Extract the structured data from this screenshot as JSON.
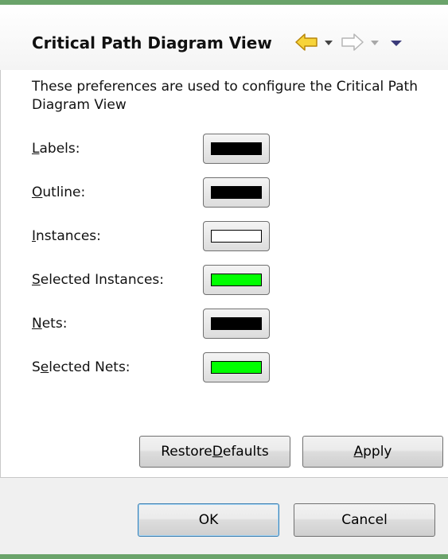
{
  "header": {
    "title": "Critical Path Diagram View",
    "icons": [
      "back-arrow-icon",
      "back-history-dropdown-icon",
      "forward-arrow-icon",
      "forward-history-dropdown-icon",
      "view-menu-icon"
    ]
  },
  "description": "These preferences are used to configure the Critical Path Diagram View",
  "preferences": [
    {
      "mnemonic": "L",
      "rest": "abels:",
      "color": "#000000"
    },
    {
      "mnemonic": "O",
      "rest": "utline:",
      "color": "#000000"
    },
    {
      "mnemonic": "I",
      "rest": "nstances:",
      "color": "#ffffff"
    },
    {
      "mnemonic": "S",
      "rest": "elected Instances:",
      "color": "#00ff00"
    },
    {
      "mnemonic": "N",
      "rest": "ets:",
      "color": "#000000"
    },
    {
      "pre": "S",
      "mnemonic": "e",
      "rest": "lected Nets:",
      "color": "#00ff00"
    }
  ],
  "buttons": {
    "restore_pre": "Restore ",
    "restore_mnemonic": "D",
    "restore_rest": "efaults",
    "apply_mnemonic": "A",
    "apply_rest": "pply",
    "ok": "OK",
    "cancel": "Cancel"
  },
  "colors": {
    "back_arrow": "#f5c400",
    "accent_green": "#6aa36a"
  }
}
